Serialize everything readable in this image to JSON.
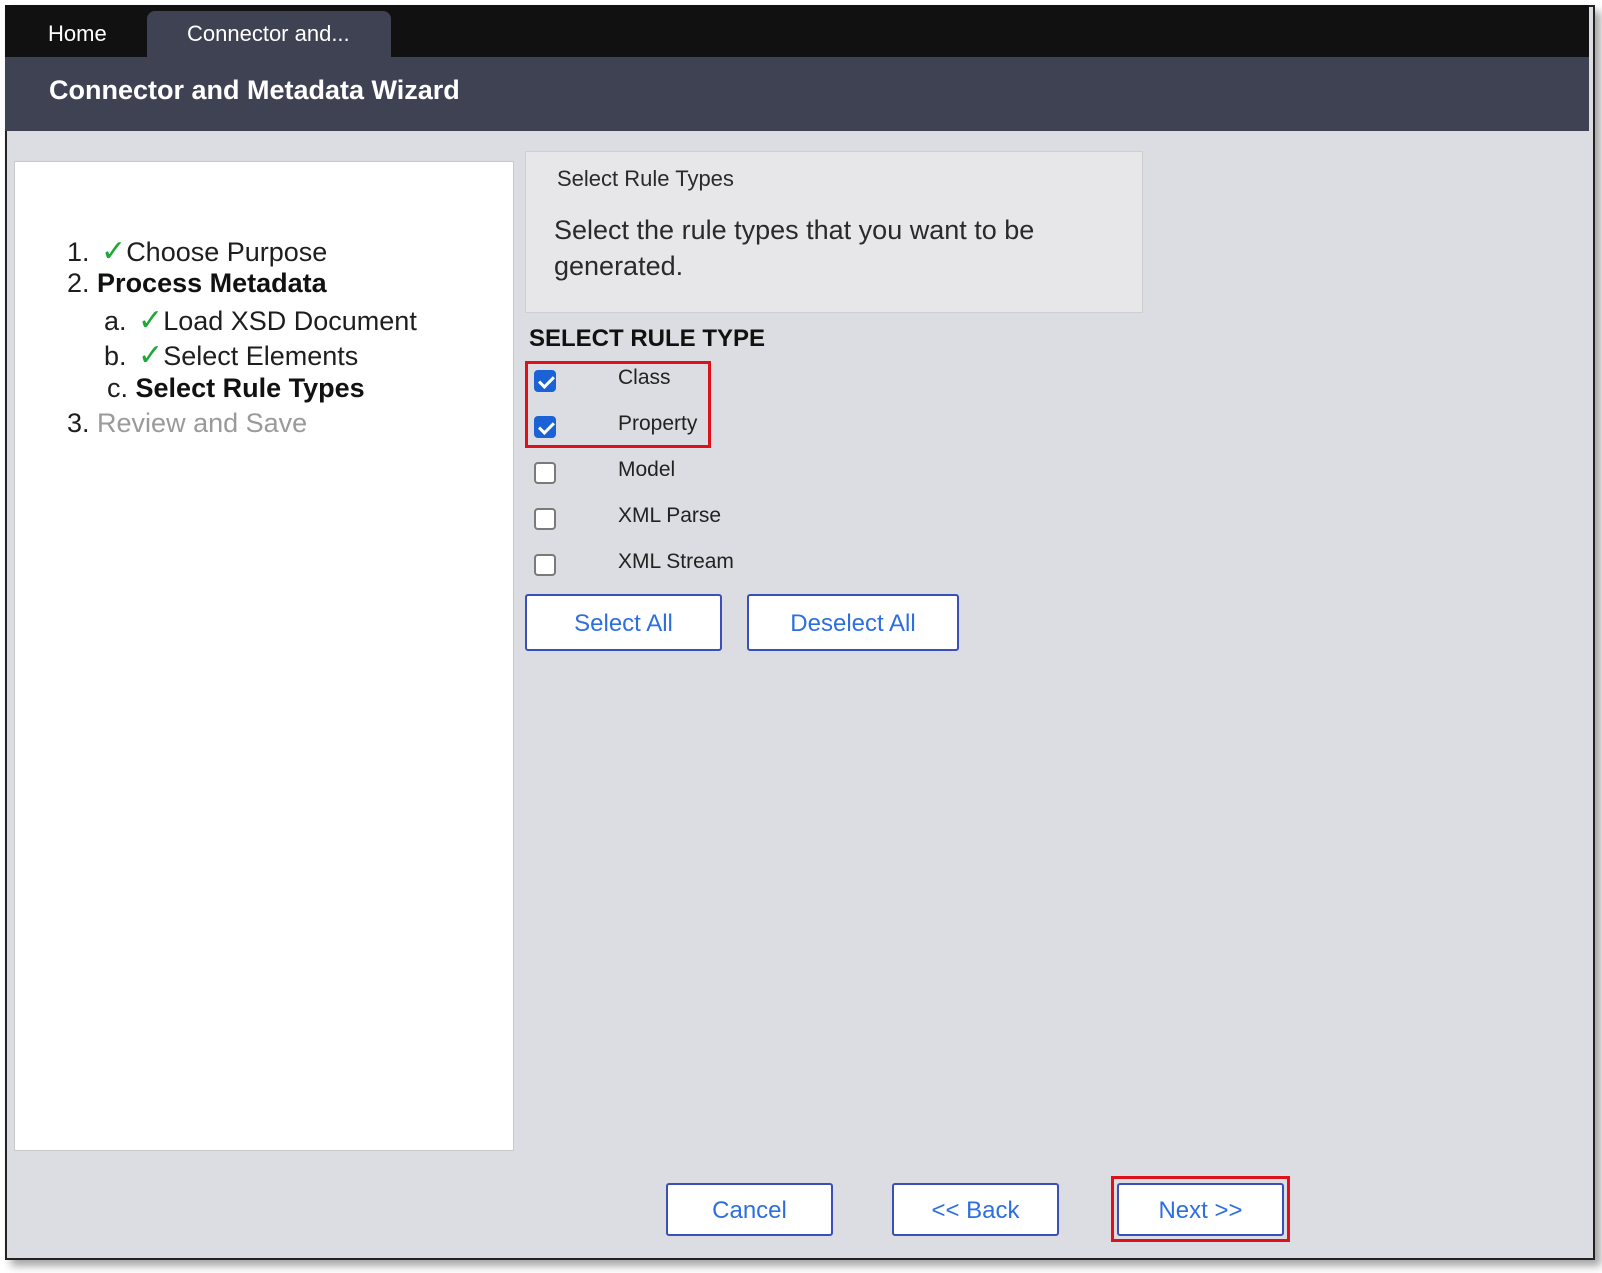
{
  "tabs": [
    {
      "label": "Home"
    },
    {
      "label": "Connector and..."
    }
  ],
  "header": {
    "title": "Connector and Metadata Wizard"
  },
  "steps": [
    {
      "number": "1.",
      "label": "Choose Purpose",
      "state": "complete"
    },
    {
      "number": "2.",
      "label": "Process Metadata",
      "state": "current"
    },
    {
      "number": "a.",
      "label": "Load XSD Document",
      "state": "complete"
    },
    {
      "number": "b.",
      "label": "Select Elements",
      "state": "complete"
    },
    {
      "number": "c.",
      "label": "Select Rule Types",
      "state": "current"
    },
    {
      "number": "3.",
      "label": "Review and Save",
      "state": "pending"
    }
  ],
  "check_glyph": "✓",
  "info": {
    "title": "Select Rule Types",
    "description": "Select the rule types that you want to be generated."
  },
  "rule_type": {
    "section_label": "SELECT RULE TYPE",
    "options": [
      {
        "label": "Class",
        "checked": true
      },
      {
        "label": "Property",
        "checked": true
      },
      {
        "label": "Model",
        "checked": false
      },
      {
        "label": "XML Parse",
        "checked": false
      },
      {
        "label": "XML Stream",
        "checked": false
      }
    ],
    "select_all_label": "Select All",
    "deselect_all_label": "Deselect All"
  },
  "footer": {
    "cancel_label": "Cancel",
    "back_label": "<< Back",
    "next_label": "Next >>"
  },
  "colors": {
    "header_bg": "#3f4253",
    "tabbar_bg": "#111111",
    "check_green": "#1fa83a",
    "button_border": "#3b4fb8",
    "button_text": "#2d6fe0",
    "highlight_red": "#e0101a",
    "checkbox_blue": "#1a62d6"
  }
}
